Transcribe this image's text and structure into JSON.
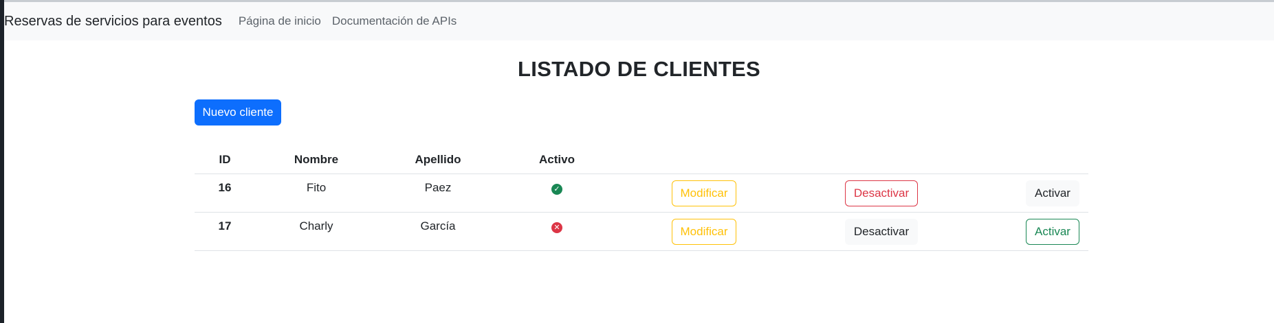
{
  "navbar": {
    "brand": "Reservas de servicios para eventos",
    "links": [
      "Página de inicio",
      "Documentación de APIs"
    ]
  },
  "page": {
    "title": "LISTADO DE CLIENTES",
    "new_button": "Nuevo cliente"
  },
  "table": {
    "headers": [
      "ID",
      "Nombre",
      "Apellido",
      "Activo"
    ],
    "rows": [
      {
        "id": "16",
        "nombre": "Fito",
        "apellido": "Paez",
        "activo": true,
        "activo_icon": "check-circle-icon",
        "modificar": "Modificar",
        "desactivar": "Desactivar",
        "activar": "Activar"
      },
      {
        "id": "17",
        "nombre": "Charly",
        "apellido": "García",
        "activo": false,
        "activo_icon": "x-circle-icon",
        "modificar": "Modificar",
        "desactivar": "Desactivar",
        "activar": "Activar"
      }
    ]
  },
  "colors": {
    "primary": "#0d6efd",
    "warning": "#ffc107",
    "danger": "#dc3545",
    "success": "#198754",
    "light": "#f8f9fa"
  }
}
